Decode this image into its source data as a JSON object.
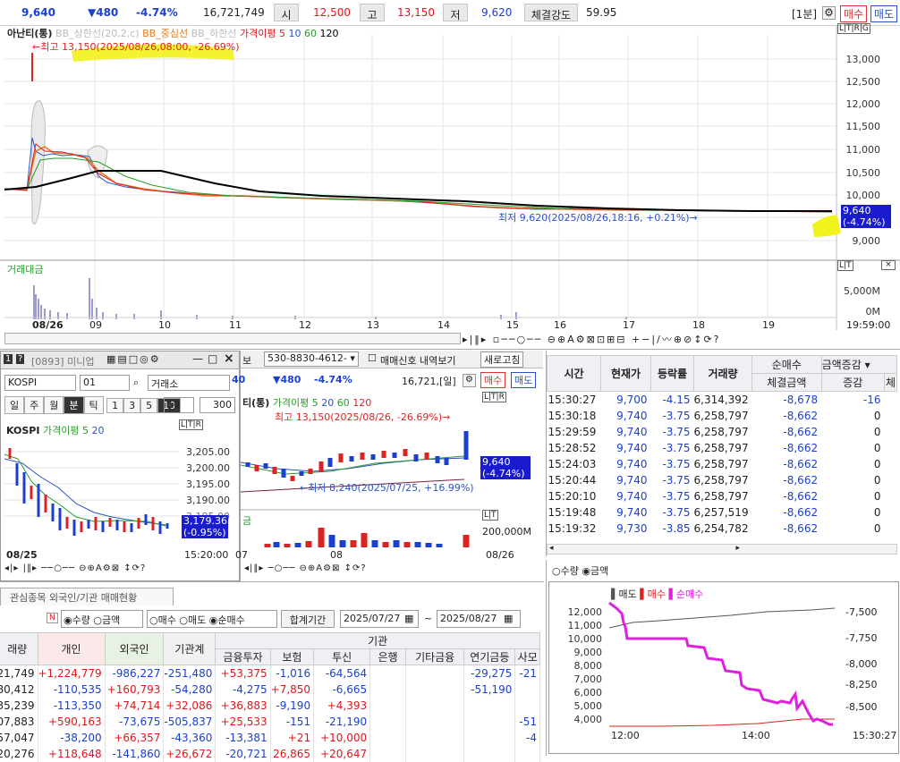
{
  "topbar": {
    "price": "9,640",
    "change": "▼480",
    "pct": "-4.74%",
    "volume": "16,721,749",
    "open_label": "시",
    "open": "12,500",
    "high_label": "고",
    "high": "13,150",
    "low_label": "저",
    "low": "9,620",
    "strength_label": "체결강도",
    "strength": "59.95",
    "interval": "[1분]",
    "buy": "매수",
    "sell": "매도"
  },
  "main_chart": {
    "legend_name": "아난티(통)",
    "legend_bb_up": "BB_상한선(20,2,c)",
    "legend_bb_mid": "BB_중심선",
    "legend_bb_low": "BB_하한선",
    "legend_ma": "가격이평 5",
    "legend_ma10": "10",
    "legend_ma60": "60",
    "legend_ma120": "120",
    "max_annot": "←최고 13,150(2025/08/26,08:00, -26.69%)",
    "min_annot": "최저 9,620(2025/08/26,18:16, +0.21%)→",
    "last_price": "9,640",
    "last_pct": "(-4.74%)",
    "y_ticks": [
      "13,000",
      "12,500",
      "12,000",
      "11,500",
      "11,000",
      "10,500",
      "10,000",
      "9,500",
      "9,000"
    ],
    "vol_label": "거래대금",
    "vol_ticks": [
      "5,000M",
      "0M"
    ],
    "x_labels": [
      "08/26",
      "09",
      "10",
      "11",
      "12",
      "13",
      "14",
      "15",
      "16",
      "17",
      "18",
      "19"
    ],
    "time_label": "19:59:00"
  },
  "mini": {
    "title": "[0893] 미니업",
    "code": "KOSPI",
    "code2": "01",
    "market": "거래소",
    "period_buttons": [
      "일",
      "주",
      "월",
      "분",
      "틱",
      "1",
      "3",
      "5",
      "10"
    ],
    "period_val": "10",
    "count": "300",
    "legend_name": "KOSPI",
    "legend_ma": "가격이평 5",
    "legend_ma2": "20",
    "y_ticks": [
      "3,205.00",
      "3,200.00",
      "3,195.00",
      "3,190.00",
      "3,185.00"
    ],
    "last": "3,179.36",
    "last_pct": "(-0.95%)",
    "date": "08/25",
    "time": "15:20:00"
  },
  "daily": {
    "account": "530-8830-4612-",
    "signal_label": "매매신호 내역보기",
    "refresh": "새로고침",
    "price_tail": "40",
    "change": "▼480",
    "pct": "-4.74%",
    "volume": "16,721,[일]",
    "buy": "매수",
    "sell": "매도",
    "legend_name": "티(통)",
    "legend_ma": "가격이평 5",
    "legend_ma20": "20",
    "legend_ma60": "60",
    "legend_ma120": "120",
    "max_annot": "최고 13,150(2025/08/26, -26.69%)→",
    "min_annot": "←최저 8,240(2025/07/25, +16.99%)",
    "last": "9,640",
    "last_pct": "(-4.74%)",
    "vol_label": "금",
    "vol_tick": "200,000M",
    "x1": "07",
    "x2": "08",
    "x3": "08/26"
  },
  "ticks": {
    "headers": [
      "시간",
      "현재가",
      "등락률",
      "거래량",
      "순매수",
      "체결금액",
      "증감",
      "매"
    ],
    "sub_header": "금액증감",
    "rows": [
      [
        "15:30:27",
        "9,700",
        "-4.15",
        "6,314,392",
        "-8,678",
        "-16"
      ],
      [
        "15:30:18",
        "9,740",
        "-3.75",
        "6,258,797",
        "-8,662",
        "0"
      ],
      [
        "15:29:59",
        "9,740",
        "-3.75",
        "6,258,797",
        "-8,662",
        "0"
      ],
      [
        "15:28:52",
        "9,740",
        "-3.75",
        "6,258,797",
        "-8,662",
        "0"
      ],
      [
        "15:24:03",
        "9,740",
        "-3.75",
        "6,258,797",
        "-8,662",
        "0"
      ],
      [
        "15:20:44",
        "9,740",
        "-3.75",
        "6,258,797",
        "-8,662",
        "0"
      ],
      [
        "15:20:10",
        "9,740",
        "-3.75",
        "6,258,797",
        "-8,662",
        "0"
      ],
      [
        "15:19:48",
        "9,740",
        "-3.75",
        "6,257,519",
        "-8,662",
        "0"
      ],
      [
        "15:19:32",
        "9,730",
        "-3.85",
        "6,254,782",
        "-8,662",
        "0"
      ]
    ]
  },
  "flow_chart": {
    "radio_qty": "수량",
    "radio_amt": "금액",
    "legend_sell": "매도",
    "legend_buy": "매수",
    "legend_net": "순매수",
    "left_ticks": [
      "12,000",
      "11,000",
      "10,000",
      "9,000",
      "8,000",
      "7,000",
      "6,000",
      "5,000",
      "4,000"
    ],
    "right_ticks": [
      "-7,500",
      "-7,750",
      "-8,000",
      "-8,250",
      "-8,500"
    ],
    "x_labels": [
      "12:00",
      "14:00"
    ],
    "time": "15:30:27"
  },
  "investor": {
    "tab": "관심종목 외국인/기관 매매현황",
    "radio_qty": "수량",
    "radio_amt": "금액",
    "radio_buy": "매수",
    "radio_sell": "매도",
    "radio_net": "순매수",
    "period_label": "합계기간",
    "date_from": "2025/07/27",
    "date_to": "2025/08/27",
    "group_header": "기관",
    "headers": [
      "래량",
      "개인",
      "외국인",
      "기관계",
      "금융투자",
      "보험",
      "투신",
      "은행",
      "기타금융",
      "연기금등",
      "사모"
    ],
    "rows": [
      [
        "21,749",
        "+1,224,779",
        "-986,227",
        "-251,480",
        "+53,375",
        "-1,016",
        "-64,564",
        "",
        "",
        "-29,275",
        "-21"
      ],
      [
        "80,412",
        "-110,535",
        "+160,793",
        "-54,280",
        "-4,275",
        "+7,850",
        "-6,665",
        "",
        "",
        "-51,190",
        ""
      ],
      [
        "35,239",
        "-113,350",
        "+74,714",
        "+32,086",
        "+36,883",
        "-9,190",
        "+4,393",
        "",
        "",
        "",
        ""
      ],
      [
        "07,883",
        "+590,163",
        "-73,675",
        "-505,837",
        "+25,533",
        "-151",
        "-21,190",
        "",
        "",
        "",
        "-51"
      ],
      [
        "57,047",
        "-38,200",
        "+66,357",
        "-43,360",
        "-13,381",
        "+21",
        "+10,000",
        "",
        "",
        "",
        "-4"
      ],
      [
        "20,276",
        "+118,648",
        "-141,860",
        "+26,672",
        "-20,721",
        "26,865",
        "+20,647",
        "",
        "",
        "",
        ""
      ]
    ]
  }
}
